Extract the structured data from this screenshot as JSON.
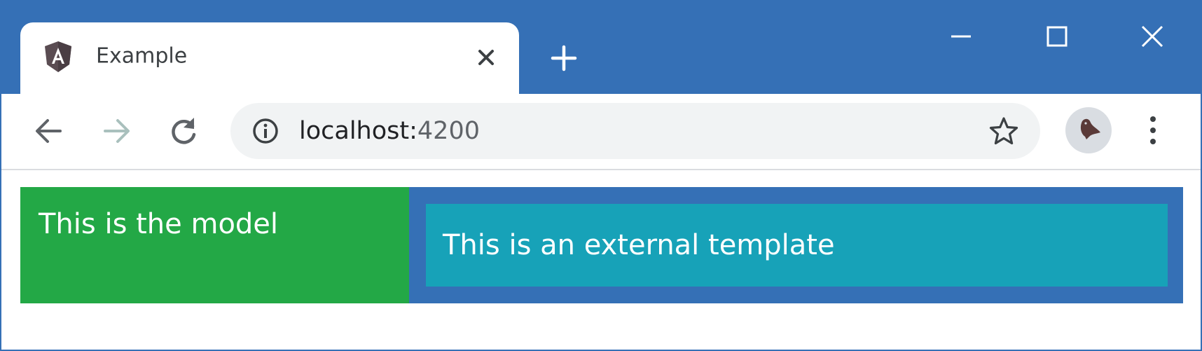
{
  "browser": {
    "tab": {
      "title": "Example",
      "favicon": "angular-icon"
    },
    "window_controls": [
      "minimize-icon",
      "maximize-icon",
      "close-icon"
    ],
    "toolbar": {
      "back_icon": "back-arrow-icon",
      "forward_icon": "forward-arrow-icon",
      "reload_icon": "reload-icon",
      "info_icon": "info-icon",
      "url_host": "localhost:",
      "url_port": "4200",
      "bookmark_icon": "star-icon",
      "menu_icon": "more-vert-icon"
    },
    "colors": {
      "titlebar": "#3570b6",
      "tab": "#ffffff",
      "omnibox": "#f1f3f4"
    }
  },
  "page": {
    "model_text": "This is the model",
    "template_text": "This is an external template",
    "colors": {
      "model_bg": "#23a846",
      "outer_bg": "#3570b6",
      "inner_bg": "#17a2b8",
      "text": "#ffffff"
    }
  }
}
